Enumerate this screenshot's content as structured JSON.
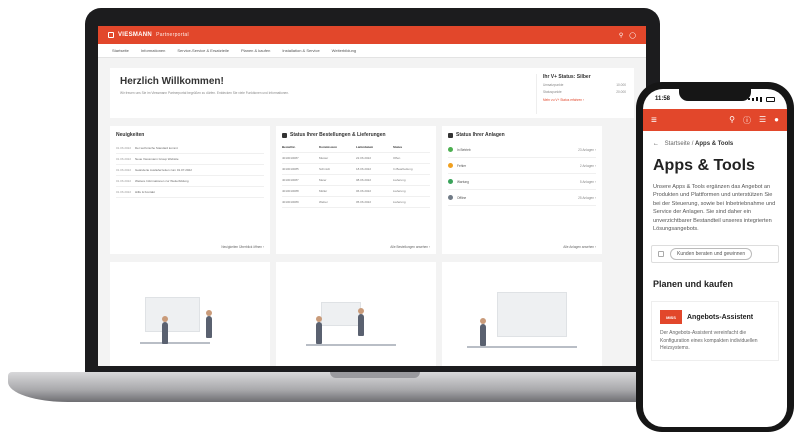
{
  "laptop": {
    "brand": "VIESMANN",
    "brand_sub": "Partnerportal",
    "top_icons": [
      "search-icon",
      "user-icon"
    ],
    "nav": [
      "Startseite",
      "Informationen",
      "Service-Service & Ersatzteile",
      "Planen & kaufen",
      "Installation & Service",
      "Weiterbildung"
    ],
    "welcome_title": "Herzlich Willkommen!",
    "welcome_text": "Wir freuen uns Sie im Viessmann Partnerportal begrüßen zu dürfen. Entdecken Sie viele Funktionen und Informationen.",
    "status_title": "Ihr V+ Status: Silber",
    "status_rows": [
      {
        "label": "Umsatzpunkte",
        "value": "10.000"
      },
      {
        "label": "Statuspunkte",
        "value": "20.000"
      }
    ],
    "status_link": "Mehr zu V+ Status erfahren ›",
    "news": {
      "title": "Neuigkeiten",
      "items": [
        {
          "date": "01.06.2022",
          "text": "Der technische Standard kommt"
        },
        {
          "date": "01.06.2022",
          "text": "Neue Viessmann Group Website"
        },
        {
          "date": "01.06.2022",
          "text": "Geänderte Auslieferzeiten zum 01.07.2022"
        },
        {
          "date": "01.06.2022",
          "text": "Weitere Informationen zur Weiterbildung"
        },
        {
          "date": "01.06.2022",
          "text": "Hilfe & Kontakt"
        }
      ],
      "footer": "Neuigkeiten Überblick öffnen ›"
    },
    "orders": {
      "title": "Status Ihrer Bestellungen & Lieferungen",
      "headers": [
        "Bestellnr.",
        "Kommission",
        "Lieferdatum",
        "Status"
      ],
      "rows": [
        [
          "4010010087",
          "Muster",
          "22.06.2022",
          "Offen"
        ],
        [
          "4010010085",
          "Schmidt",
          "18.06.2022",
          "In Bearbeitung"
        ],
        [
          "4010010087",
          "Meier",
          "08.06.2022",
          "Lieferung"
        ],
        [
          "4010010088",
          "Müller",
          "06.06.2022",
          "Lieferung"
        ],
        [
          "4010010089",
          "Weber",
          "05.06.2022",
          "Lieferung"
        ]
      ],
      "footer": "Alle Bestellungen ansehen ›"
    },
    "plants": {
      "title": "Status Ihrer Anlagen",
      "rows": [
        {
          "label": "In Betrieb",
          "count": "23 Anlagen ›",
          "color": "#4caf50"
        },
        {
          "label": "Fehler",
          "count": "2 Anlagen ›",
          "color": "#f0a020"
        },
        {
          "label": "Wartung",
          "count": "5 Anlagen ›",
          "color": "#3aa35a"
        },
        {
          "label": "Offline",
          "count": "25 Anlagen ›",
          "color": "#707a86"
        }
      ],
      "footer": "Alle Anlagen ansehen ›"
    }
  },
  "phone": {
    "time": "11:58",
    "breadcrumb_parent": "Startseite",
    "breadcrumb_sep": "/",
    "breadcrumb_current": "Apps & Tools",
    "title": "Apps & Tools",
    "intro": "Unsere Apps & Tools ergänzen das Angebot an Produkten und Plattformen und unterstützen Sie bei der Steuerung, sowie bei Inbetriebnahme und Service der Anlagen. Sie sind daher ein unverzichtbarer Bestandteil unseres integrierten Lösungsangebots.",
    "filter_label": "Kunden beraten und gewinnen",
    "section": "Planen und kaufen",
    "tool_logo": "MISS",
    "tool_name": "Angebots-Assistent",
    "tool_desc": "Der Angebots-Assistent vereinfacht die Konfiguration eines kompakten individuellen Heizsystems."
  },
  "colors": {
    "accent": "#e2472b"
  }
}
